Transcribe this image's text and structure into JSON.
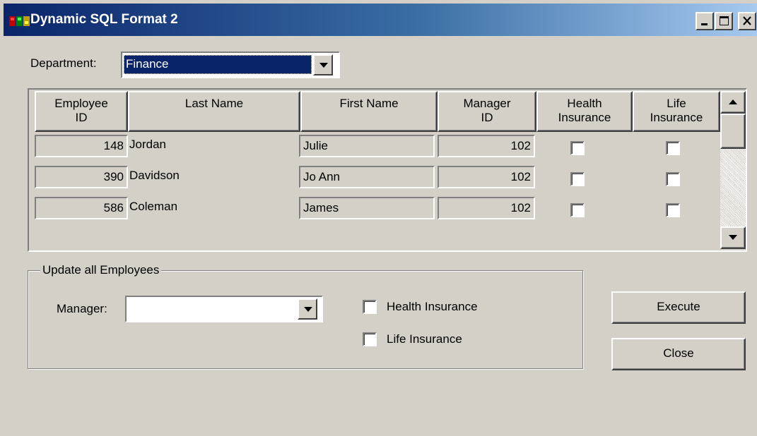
{
  "window": {
    "title": "Dynamic SQL Format 2",
    "icon": "app-icon"
  },
  "department": {
    "label": "Department:",
    "value": "Finance"
  },
  "grid": {
    "columns": [
      "Employee ID",
      "Last Name",
      "First Name",
      "Manager ID",
      "Health Insurance",
      "Life Insurance"
    ],
    "column_lines": [
      [
        "Employee",
        "ID"
      ],
      [
        "Last Name"
      ],
      [
        "First Name"
      ],
      [
        "Manager",
        "ID"
      ],
      [
        "Health",
        "Insurance"
      ],
      [
        "Life",
        "Insurance"
      ]
    ],
    "rows": [
      {
        "employee_id": "148",
        "last_name": "Jordan",
        "first_name": "Julie",
        "manager_id": "102",
        "health_insurance": false,
        "life_insurance": false
      },
      {
        "employee_id": "390",
        "last_name": "Davidson",
        "first_name": "Jo Ann",
        "manager_id": "102",
        "health_insurance": false,
        "life_insurance": false
      },
      {
        "employee_id": "586",
        "last_name": "Coleman",
        "first_name": "James",
        "manager_id": "102",
        "health_insurance": false,
        "life_insurance": false
      }
    ]
  },
  "update_group": {
    "legend": "Update all Employees",
    "manager_label": "Manager:",
    "manager_value": "",
    "health_label": "Health Insurance",
    "health_checked": false,
    "life_label": "Life Insurance",
    "life_checked": false
  },
  "buttons": {
    "execute": "Execute",
    "close": "Close"
  },
  "colors": {
    "face": "#d4d0c8",
    "title_start": "#0a246a",
    "title_end": "#a6caf0",
    "selection": "#0a246a"
  }
}
